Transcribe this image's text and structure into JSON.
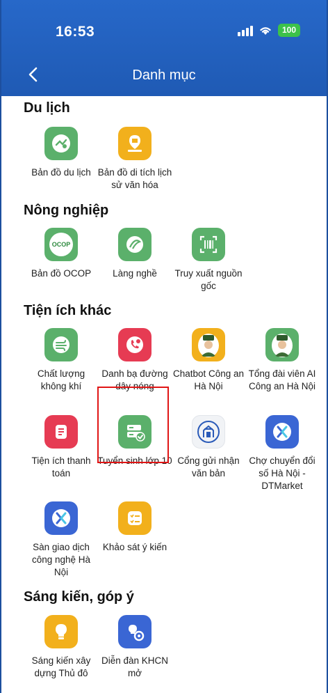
{
  "status": {
    "time": "16:53",
    "battery": "100"
  },
  "header": {
    "title": "Danh mục"
  },
  "sections": [
    {
      "title": "Du lịch",
      "items": [
        {
          "label": "Bản đồ du lịch",
          "icon": "travel-map-icon"
        },
        {
          "label": "Bản đồ di tích lịch sử văn hóa",
          "icon": "heritage-map-icon"
        }
      ]
    },
    {
      "title": "Nông nghiệp",
      "items": [
        {
          "label": "Bản đồ OCOP",
          "icon": "ocop-icon"
        },
        {
          "label": "Làng nghề",
          "icon": "craft-village-icon"
        },
        {
          "label": "Truy xuất nguồn gốc",
          "icon": "barcode-scan-icon"
        }
      ]
    },
    {
      "title": "Tiện ích khác",
      "items": [
        {
          "label": "Chất lượng không khí",
          "icon": "air-quality-icon"
        },
        {
          "label": "Danh bạ đường dây nóng",
          "icon": "hotline-phone-icon"
        },
        {
          "label": "Chatbot Công an Hà Nội",
          "icon": "police-chatbot-icon"
        },
        {
          "label": "Tổng đài viên AI Công an Hà Nội",
          "icon": "police-ai-operator-icon"
        },
        {
          "label": "Tiện ích thanh toán",
          "icon": "payment-icon"
        },
        {
          "label": "Tuyển sinh lớp 10",
          "icon": "enrollment-icon"
        },
        {
          "label": "Cổng gửi nhận văn bản",
          "icon": "document-portal-icon"
        },
        {
          "label": "Chợ chuyển đổi số Hà Nội - DTMarket",
          "icon": "dtmarket-icon"
        },
        {
          "label": "Sàn giao dịch công nghệ Hà Nội",
          "icon": "tech-exchange-icon"
        },
        {
          "label": "Khảo sát ý kiến",
          "icon": "survey-icon"
        }
      ]
    },
    {
      "title": "Sáng kiến, góp ý",
      "items": [
        {
          "label": "Sáng kiến xây dựng Thủ đô",
          "icon": "idea-bulb-icon"
        },
        {
          "label": "Diễn đàn KHCN mở",
          "icon": "science-forum-icon"
        }
      ]
    }
  ],
  "colors": {
    "header": "#2260be",
    "green": "#5bb06b",
    "yellow": "#f2b01c",
    "red": "#e63b53",
    "blue": "#3a66d4",
    "highlight": "#e01515"
  }
}
